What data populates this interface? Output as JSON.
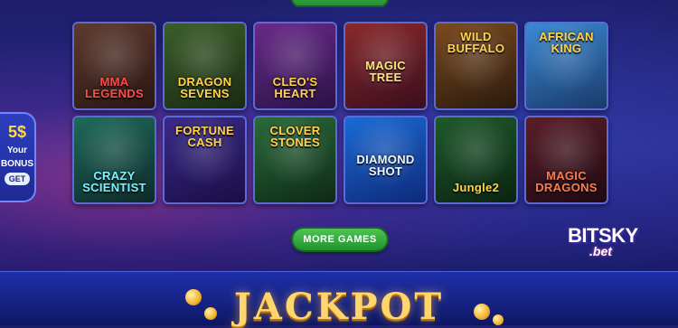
{
  "games": [
    {
      "title": "MMA LEGENDS",
      "color": "#ff4a4a",
      "bg": [
        "#5e3a2e",
        "#2a1612"
      ],
      "pos": "bottom"
    },
    {
      "title": "DRAGON SEVENS",
      "color": "#ffd24a",
      "bg": [
        "#3a5e2a",
        "#1a2a12"
      ],
      "pos": "bottom"
    },
    {
      "title": "CLEO'S HEART",
      "color": "#ffd24a",
      "bg": [
        "#6a2a8a",
        "#2a1246"
      ],
      "pos": "bottom"
    },
    {
      "title": "MAGIC TREE",
      "color": "#ffe27a",
      "bg": [
        "#8a2a2a",
        "#3a0e1e"
      ],
      "pos": "mid"
    },
    {
      "title": "WILD BUFFALO",
      "color": "#ffd24a",
      "bg": [
        "#7a4a1e",
        "#2a1a0e"
      ],
      "pos": "top"
    },
    {
      "title": "AFRICAN KING",
      "color": "#ffd24a",
      "bg": [
        "#3a8ad4",
        "#1a3a6a"
      ],
      "pos": "top"
    },
    {
      "title": "CRAZY SCIENTIST",
      "color": "#7ef0ff",
      "bg": [
        "#1e6a5a",
        "#0e2a2a"
      ],
      "pos": "bottom"
    },
    {
      "title": "FORTUNE CASH",
      "color": "#ffd24a",
      "bg": [
        "#3a2a8a",
        "#1a0e46"
      ],
      "pos": "top"
    },
    {
      "title": "CLOVER STONES",
      "color": "#ffd24a",
      "bg": [
        "#2a6a3a",
        "#0e2a16"
      ],
      "pos": "top"
    },
    {
      "title": "DIAMOND SHOT",
      "color": "#eaf6ff",
      "bg": [
        "#1a6ad4",
        "#0e2a7a"
      ],
      "pos": "mid"
    },
    {
      "title": "Jungle2",
      "color": "#ffd24a",
      "bg": [
        "#1e5a2a",
        "#0a2412"
      ],
      "pos": "bottom"
    },
    {
      "title": "MAGIC DRAGONS",
      "color": "#ff7a4a",
      "bg": [
        "#5a1e2a",
        "#1e0a12"
      ],
      "pos": "bottom"
    }
  ],
  "bonus": {
    "amount": "5$",
    "label_line1": "Your",
    "label_line2": "BONUS",
    "get_label": "GET"
  },
  "more_games_label": "MORE GAMES",
  "logo": {
    "line1": "BITSKY",
    "line2": ".bet"
  },
  "jackpot_title": "JACKPOT"
}
